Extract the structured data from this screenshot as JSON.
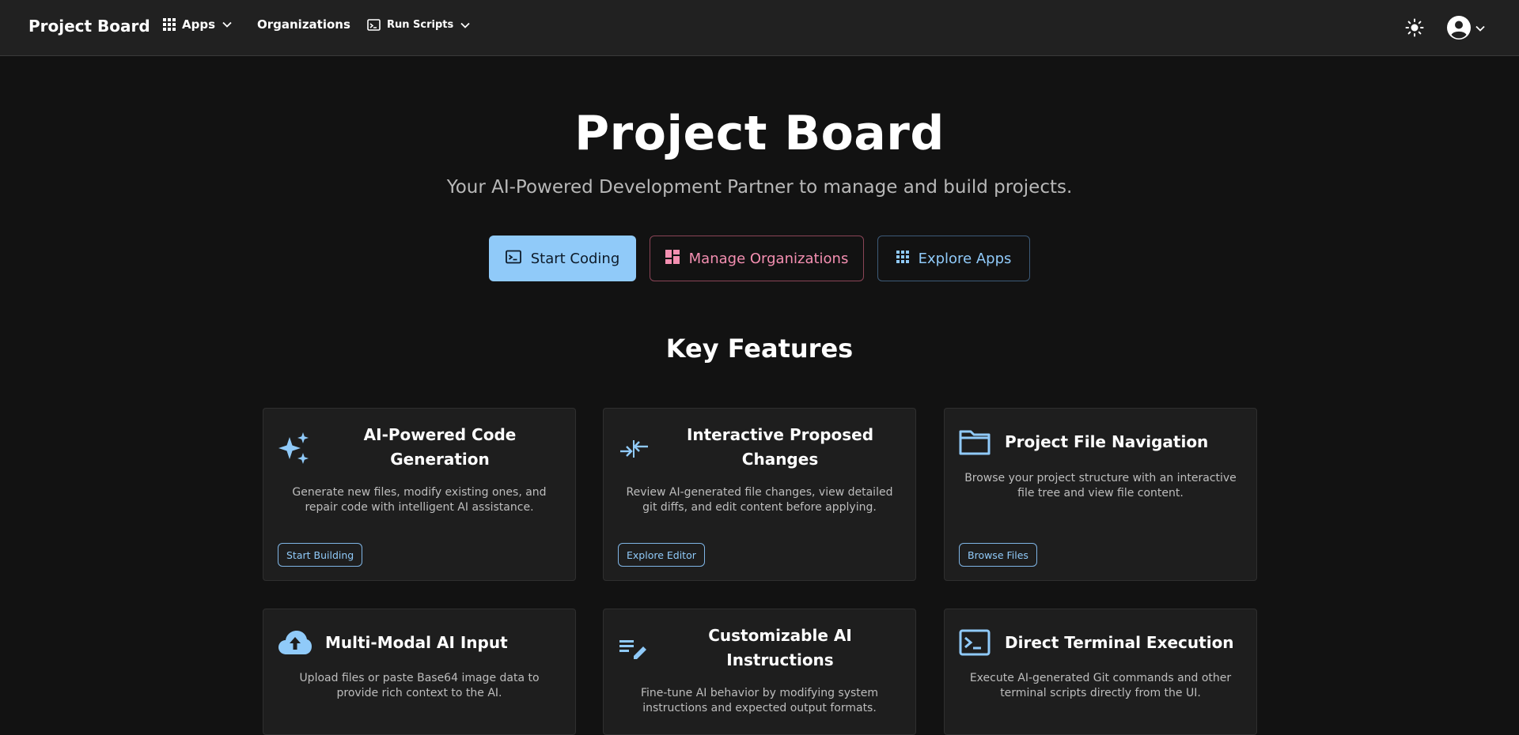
{
  "topbar": {
    "brand": "Project Board",
    "apps_label": "Apps",
    "organizations_label": "Organizations",
    "run_scripts_label": "Run Scripts"
  },
  "hero": {
    "title": "Project Board",
    "subtitle": "Your AI-Powered Development Partner to manage and build projects.",
    "start_coding": "Start Coding",
    "manage_organizations": "Manage Organizations",
    "explore_apps": "Explore Apps"
  },
  "features": {
    "heading": "Key Features",
    "cards": [
      {
        "icon": "sparkles-icon",
        "title": "AI-Powered Code Generation",
        "description": "Generate new files, modify existing ones, and repair code with intelligent AI assistance.",
        "button": "Start Building"
      },
      {
        "icon": "compare-arrows-icon",
        "title": "Interactive Proposed Changes",
        "description": "Review AI-generated file changes, view detailed git diffs, and edit content before applying.",
        "button": "Explore Editor"
      },
      {
        "icon": "folder-icon",
        "title": "Project File Navigation",
        "description": "Browse your project structure with an interactive file tree and view file content.",
        "button": "Browse Files"
      },
      {
        "icon": "cloud-upload-icon",
        "title": "Multi-Modal AI Input",
        "description": "Upload files or paste Base64 image data to provide rich context to the AI."
      },
      {
        "icon": "edit-note-icon",
        "title": "Customizable AI Instructions",
        "description": "Fine-tune AI behavior by modifying system instructions and expected output formats."
      },
      {
        "icon": "terminal-icon",
        "title": "Direct Terminal Execution",
        "description": "Execute AI-generated Git commands and other terminal scripts directly from the UI."
      }
    ]
  },
  "colors": {
    "accent_blue": "#90caf9",
    "accent_pink": "#f48fb1",
    "background": "#121212",
    "card": "#1e1e1e"
  }
}
